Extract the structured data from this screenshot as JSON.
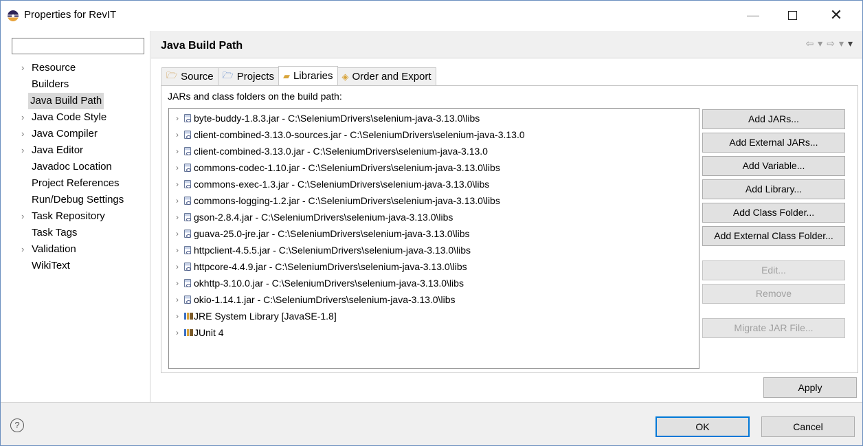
{
  "window": {
    "title": "Properties for RevIT"
  },
  "sidebar": {
    "filter_value": "",
    "items": [
      {
        "label": "Resource",
        "expandable": true,
        "selected": false
      },
      {
        "label": "Builders",
        "expandable": false,
        "selected": false
      },
      {
        "label": "Java Build Path",
        "expandable": false,
        "selected": true
      },
      {
        "label": "Java Code Style",
        "expandable": true,
        "selected": false
      },
      {
        "label": "Java Compiler",
        "expandable": true,
        "selected": false
      },
      {
        "label": "Java Editor",
        "expandable": true,
        "selected": false
      },
      {
        "label": "Javadoc Location",
        "expandable": false,
        "selected": false
      },
      {
        "label": "Project References",
        "expandable": false,
        "selected": false
      },
      {
        "label": "Run/Debug Settings",
        "expandable": false,
        "selected": false
      },
      {
        "label": "Task Repository",
        "expandable": true,
        "selected": false
      },
      {
        "label": "Task Tags",
        "expandable": false,
        "selected": false
      },
      {
        "label": "Validation",
        "expandable": true,
        "selected": false
      },
      {
        "label": "WikiText",
        "expandable": false,
        "selected": false
      }
    ]
  },
  "page": {
    "title": "Java Build Path",
    "tabs": [
      {
        "label": "Source",
        "icon": "source-folder-icon",
        "active": false
      },
      {
        "label": "Projects",
        "icon": "projects-folder-icon",
        "active": false
      },
      {
        "label": "Libraries",
        "icon": "libraries-icon",
        "active": true
      },
      {
        "label": "Order and Export",
        "icon": "order-export-icon",
        "active": false
      }
    ],
    "section_label": "JARs and class folders on the build path:",
    "libraries": [
      {
        "text": "byte-buddy-1.8.3.jar - C:\\SeleniumDrivers\\selenium-java-3.13.0\\libs",
        "icon": "jar-icon"
      },
      {
        "text": "client-combined-3.13.0-sources.jar - C:\\SeleniumDrivers\\selenium-java-3.13.0",
        "icon": "jar-icon"
      },
      {
        "text": "client-combined-3.13.0.jar - C:\\SeleniumDrivers\\selenium-java-3.13.0",
        "icon": "jar-icon"
      },
      {
        "text": "commons-codec-1.10.jar - C:\\SeleniumDrivers\\selenium-java-3.13.0\\libs",
        "icon": "jar-icon"
      },
      {
        "text": "commons-exec-1.3.jar - C:\\SeleniumDrivers\\selenium-java-3.13.0\\libs",
        "icon": "jar-icon"
      },
      {
        "text": "commons-logging-1.2.jar - C:\\SeleniumDrivers\\selenium-java-3.13.0\\libs",
        "icon": "jar-icon"
      },
      {
        "text": "gson-2.8.4.jar - C:\\SeleniumDrivers\\selenium-java-3.13.0\\libs",
        "icon": "jar-icon"
      },
      {
        "text": "guava-25.0-jre.jar - C:\\SeleniumDrivers\\selenium-java-3.13.0\\libs",
        "icon": "jar-icon"
      },
      {
        "text": "httpclient-4.5.5.jar - C:\\SeleniumDrivers\\selenium-java-3.13.0\\libs",
        "icon": "jar-icon"
      },
      {
        "text": "httpcore-4.4.9.jar - C:\\SeleniumDrivers\\selenium-java-3.13.0\\libs",
        "icon": "jar-icon"
      },
      {
        "text": "okhttp-3.10.0.jar - C:\\SeleniumDrivers\\selenium-java-3.13.0\\libs",
        "icon": "jar-icon"
      },
      {
        "text": "okio-1.14.1.jar - C:\\SeleniumDrivers\\selenium-java-3.13.0\\libs",
        "icon": "jar-icon"
      },
      {
        "text": "JRE System Library [JavaSE-1.8]",
        "icon": "library-icon"
      },
      {
        "text": "JUnit 4",
        "icon": "library-icon"
      }
    ],
    "buttons": [
      {
        "label": "Add JARs...",
        "enabled": true
      },
      {
        "label": "Add External JARs...",
        "enabled": true
      },
      {
        "label": "Add Variable...",
        "enabled": true
      },
      {
        "label": "Add Library...",
        "enabled": true
      },
      {
        "label": "Add Class Folder...",
        "enabled": true
      },
      {
        "label": "Add External Class Folder...",
        "enabled": true
      },
      {
        "label": "Edit...",
        "enabled": false
      },
      {
        "label": "Remove",
        "enabled": false
      },
      {
        "label": "Migrate JAR File...",
        "enabled": false
      }
    ],
    "apply_label": "Apply"
  },
  "footer": {
    "help_icon": "help-icon",
    "ok_label": "OK",
    "cancel_label": "Cancel"
  }
}
